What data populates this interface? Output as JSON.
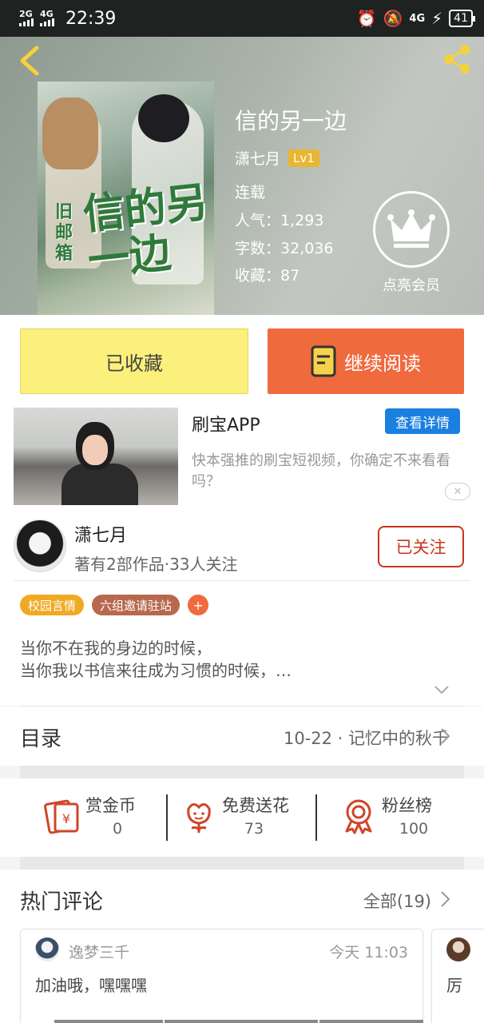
{
  "status_bar": {
    "net1": "2G",
    "net2": "4G",
    "time": "22:39",
    "net_right": "4G",
    "battery": "41"
  },
  "book": {
    "title": "信的另一边",
    "author": "潇七月",
    "level": "Lv1",
    "status": "连载",
    "popularity_label": "人气：",
    "popularity": "1,293",
    "words_label": "字数：",
    "words": "32,036",
    "favorites_label": "收藏：",
    "favorites": "87",
    "vip_label": "点亮会员",
    "cover_title": "信的另一边",
    "cover_sub": "旧邮箱"
  },
  "actions": {
    "collect_label": "已收藏",
    "read_label": "继续阅读"
  },
  "ad": {
    "title": "刷宝APP",
    "button": "查看详情",
    "description": "快本强推的刷宝短视频，你确定不来看看吗？",
    "close": "✕"
  },
  "author": {
    "name": "潇七月",
    "summary": "著有2部作品·33人关注",
    "follow_label": "已关注"
  },
  "tags": [
    "校园言情",
    "六组邀请驻站",
    "+"
  ],
  "intro": {
    "line1": "当你不在我的身边的时候，",
    "line2": "当你我以书信来往成为习惯的时候，…"
  },
  "toc": {
    "label": "目录",
    "latest": "10-22 · 记忆中的秋千"
  },
  "rewards": [
    {
      "label": "赏金币",
      "value": "0",
      "icon": "gold-coin-icon"
    },
    {
      "label": "免费送花",
      "value": "73",
      "icon": "flower-icon"
    },
    {
      "label": "粉丝榜",
      "value": "100",
      "icon": "ribbon-medal-icon"
    }
  ],
  "comments": {
    "label": "热门评论",
    "all_label": "全部(19)",
    "items": [
      {
        "user": "逸梦三千",
        "time": "今天 11:03",
        "text": "加油哦，嘿嘿嘿"
      },
      {
        "user": "",
        "time": "",
        "text": "厉"
      }
    ]
  },
  "colors": {
    "accent_orange": "#ef6a3d",
    "collect_yellow": "#fbf07c",
    "follow_red": "#c8351b",
    "ad_blue": "#1b7fe0",
    "tag_yellow": "#f0a925",
    "tag_brown": "#b8684f"
  }
}
